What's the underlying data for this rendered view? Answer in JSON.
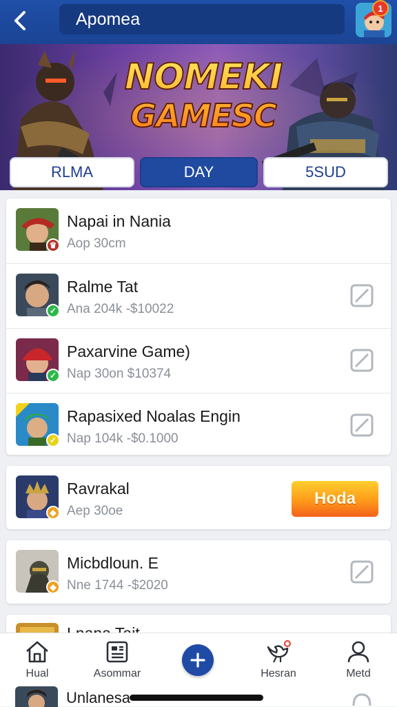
{
  "header": {
    "search_value": "Apomea",
    "notification_count": "1"
  },
  "banner": {
    "title_line1": "NOMEKI",
    "title_line2": "GAMESC"
  },
  "tabs": [
    {
      "label": "RLMA",
      "active": false
    },
    {
      "label": "DAY",
      "active": true
    },
    {
      "label": "5SUD",
      "active": false
    }
  ],
  "list": [
    {
      "title": "Napai in Nania",
      "meta": "Aop 30cm",
      "badge": "♛",
      "badge_color": "#b5322a",
      "action": "none"
    },
    {
      "title": "Ralme Tat",
      "meta": "Ana 204k -$10022",
      "badge": "✓",
      "badge_color": "#2db84a",
      "action": "check"
    },
    {
      "title": "Paxarvine Game)",
      "meta": "Nap 30on  $10374",
      "badge": "✓",
      "badge_color": "#2db84a",
      "action": "check"
    },
    {
      "title": "Rapasixed Noalas Engin",
      "meta": "Nap 104k -$0.1000",
      "badge": "✓",
      "badge_color": "#e9d21a",
      "action": "check"
    },
    {
      "title": "Ravrakal",
      "meta": "Aep 30oe",
      "badge": "◆",
      "badge_color": "#f0a020",
      "action": "get",
      "action_label": "Hoda"
    },
    {
      "title": "Micbdloun. E",
      "meta": "Nne 1744 -$2020",
      "badge": "◆",
      "badge_color": "#f0a020",
      "action": "check"
    },
    {
      "title": "Lnana Tait",
      "meta": "",
      "badge": "",
      "badge_color": "",
      "action": "none"
    }
  ],
  "peek": {
    "title": "Unlanesa"
  },
  "nav": [
    {
      "label": "Hual",
      "icon": "home-icon"
    },
    {
      "label": "Asommar",
      "icon": "news-icon"
    },
    {
      "label": "",
      "icon": "plus-icon"
    },
    {
      "label": "Hesran",
      "icon": "bird-icon"
    },
    {
      "label": "Metd",
      "icon": "user-icon"
    }
  ],
  "colors": {
    "primary": "#1f4aa0",
    "accent": "#ff9a1a",
    "background": "#eef0f3"
  }
}
